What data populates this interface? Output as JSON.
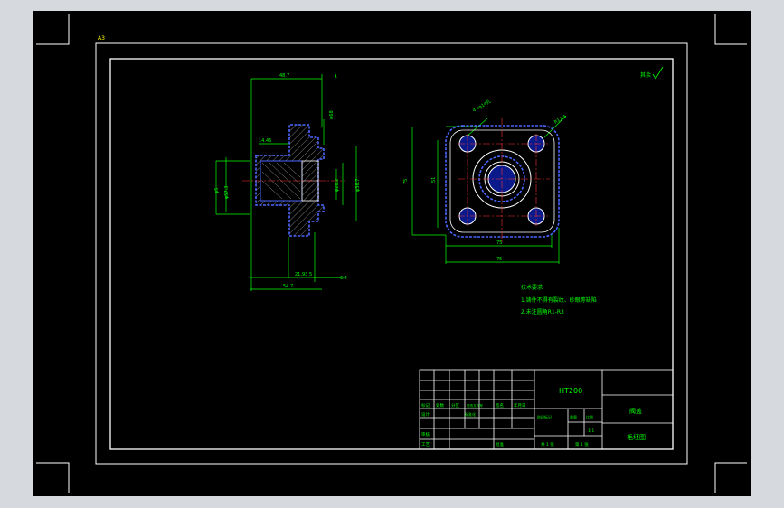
{
  "drawing": {
    "corner_mark": "A3",
    "roughness": "其余",
    "material": "HT200",
    "part_name_top": "阀盖",
    "part_name_bottom": "毛坯图"
  },
  "tech_requirements": {
    "title": "技术要求",
    "line1": "1.铸件不得有裂纹、砂眼等缺陷",
    "line2": "2.未注圆角R1-R3"
  },
  "title_block": {
    "col_labels": [
      "标记",
      "处数",
      "分区",
      "更改文件号",
      "签名",
      "年月日"
    ],
    "sign_labels": [
      "设计",
      "标准化",
      "审核",
      "工艺",
      "批准"
    ],
    "stage_label": "阶段标记",
    "weight_label": "重量",
    "scale_label": "比例",
    "scale_value": "1:1",
    "sheet_total": "共 1 张",
    "sheet_no": "第 1 张"
  },
  "dimensions": {
    "left_top_width": "48.7",
    "left_flange_thk": "14.46",
    "left_step": "φ68",
    "left_bore1": "φ57.3",
    "left_side": "φ5",
    "left_inner1": "φ28.2",
    "left_inner2": "φ36.7",
    "left_bottom1": "21.93",
    "left_bottom2": "5",
    "left_bottom3": "6.4",
    "left_bottom_total": "54.7",
    "right_hole_callout": "4×φ14孔",
    "right_radius": "R12.5",
    "right_height_outer": "75",
    "right_height_inner": "51",
    "right_width_inner": "75",
    "right_width_outer": "75"
  }
}
